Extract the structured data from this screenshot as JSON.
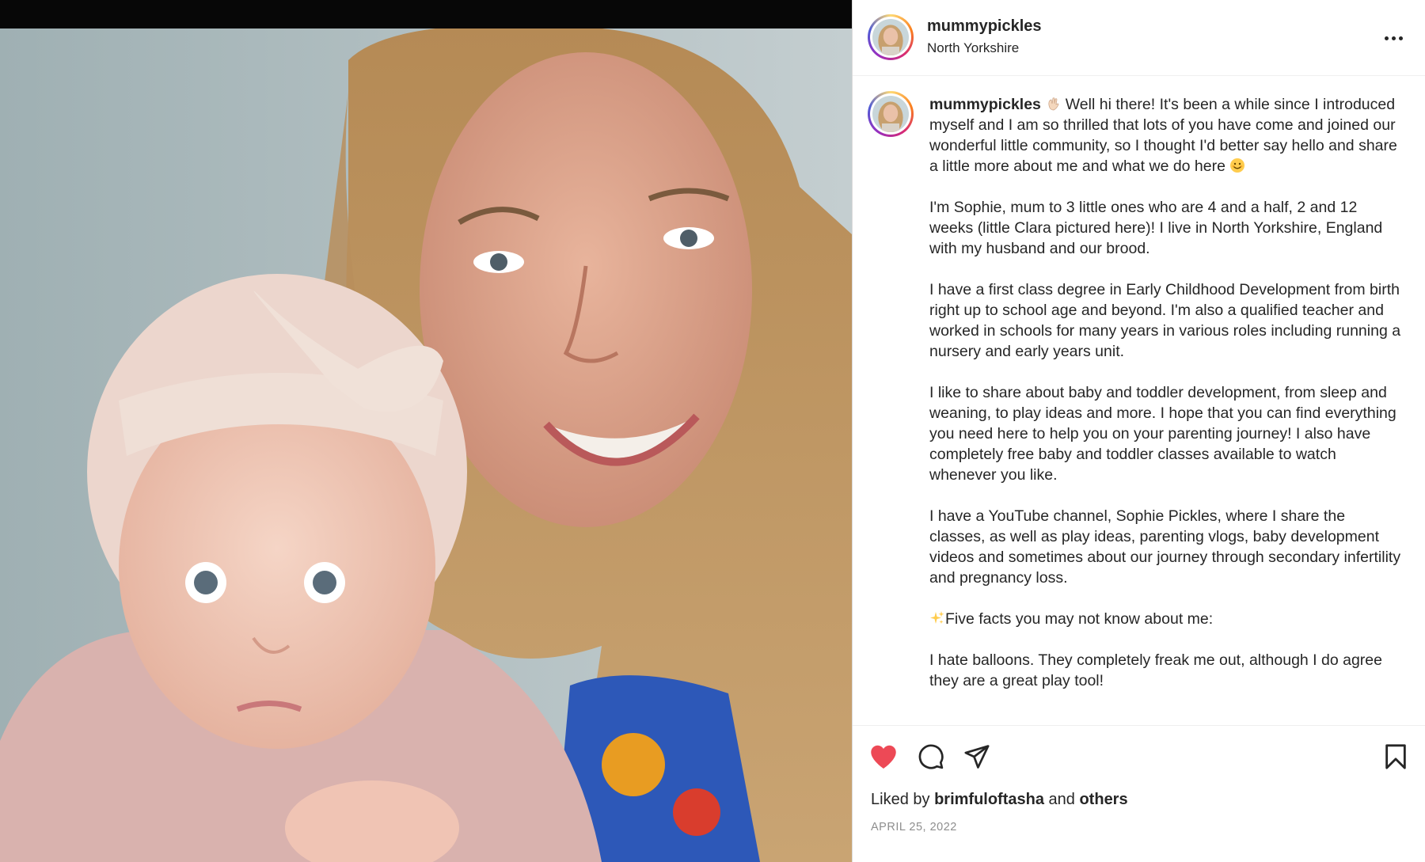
{
  "post": {
    "username": "mummypickles",
    "location": "North Yorkshire",
    "caption": {
      "username": "mummypickles",
      "intro": "Well hi there! It's been a while since I introduced myself and I am so thrilled that lots of you have come and joined our wonderful little community, so I thought I'd better say hello and share a little more about me and what we do here",
      "paragraphs": [
        "I'm Sophie, mum to 3 little ones who are 4 and a half, 2 and 12 weeks (little Clara pictured here)! I live in North Yorkshire, England with my husband and our brood.",
        "I have a first class degree in Early Childhood Development from birth right up to school age and beyond. I'm also a qualified teacher and worked in schools for many years in various roles including running a nursery and early years unit.",
        "I like to share about baby and toddler development, from sleep and weaning, to play ideas and more. I hope that you can find everything you need here to help you on your parenting journey! I also have completely free baby and toddler classes available to watch whenever you like.",
        "I have a YouTube channel, Sophie Pickles, where I share the classes, as well as play ideas, parenting vlogs, baby development videos and sometimes about our journey through secondary infertility and pregnancy loss."
      ],
      "facts_heading": "Five facts you may not know about me:",
      "fact_1": "I hate balloons. They completely freak me out, although I do agree they are a great play tool!"
    },
    "likes": {
      "prefix": "Liked by",
      "user": "brimfuloftasha",
      "joiner": "and",
      "others": "others"
    },
    "date": "APRIL 25, 2022"
  },
  "icons": {
    "more": "more-horizontal-icon",
    "like": "heart-filled-icon",
    "comment": "comment-icon",
    "share": "paper-plane-icon",
    "save": "bookmark-icon",
    "wave": "waving-hand-emoji",
    "smile": "smiling-face-emoji",
    "sparkles": "sparkles-emoji"
  },
  "colors": {
    "like": "#ed4956",
    "text": "#262626",
    "muted": "#8e8e8e"
  }
}
